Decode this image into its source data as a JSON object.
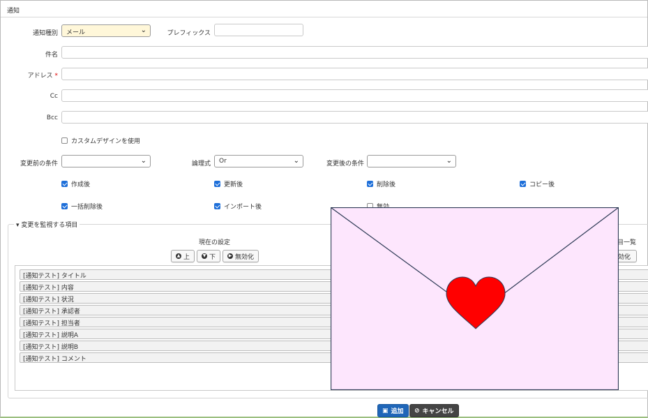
{
  "panel": {
    "title": "通知"
  },
  "form": {
    "notification_type_label": "通知種別",
    "notification_type_value": "メール",
    "prefix_label": "プレフィックス",
    "subject_label": "件名",
    "address_label": "アドレス",
    "required_mark": "*",
    "cc_label": "Cc",
    "bcc_label": "Bcc",
    "custom_design_label": "カスタムデザインを使用",
    "before_condition_label": "変更前の条件",
    "logic_label": "論理式",
    "logic_value": "Or",
    "after_condition_label": "変更後の条件"
  },
  "triggers": [
    {
      "label": "作成後",
      "checked": true
    },
    {
      "label": "更新後",
      "checked": true
    },
    {
      "label": "削除後",
      "checked": true
    },
    {
      "label": "コピー後",
      "checked": true
    },
    {
      "label": "一括削除後",
      "checked": true
    },
    {
      "label": "インポート後",
      "checked": true
    },
    {
      "label": "無効",
      "checked": false
    }
  ],
  "monitor": {
    "legend": "変更を監視する項目",
    "current_title": "現在の設定",
    "right_title_partial": "項目一覧",
    "btn_up": "上",
    "btn_down": "下",
    "btn_disable": "無効化",
    "btn_disable_partial": "無効化",
    "items": [
      "[通知テスト] タイトル",
      "[通知テスト] 内容",
      "[通知テスト] 状況",
      "[通知テスト] 承認者",
      "[通知テスト] 担当者",
      "[通知テスト] 説明A",
      "[通知テスト] 説明B",
      "[通知テスト] コメント"
    ]
  },
  "footer": {
    "add_label": "追加",
    "cancel_label": "キャンセル"
  },
  "overlay": {
    "icon": "envelope-heart-icon",
    "fill": "#fde6fd",
    "heart": "#ff0000",
    "stroke": "#2d3a55"
  }
}
